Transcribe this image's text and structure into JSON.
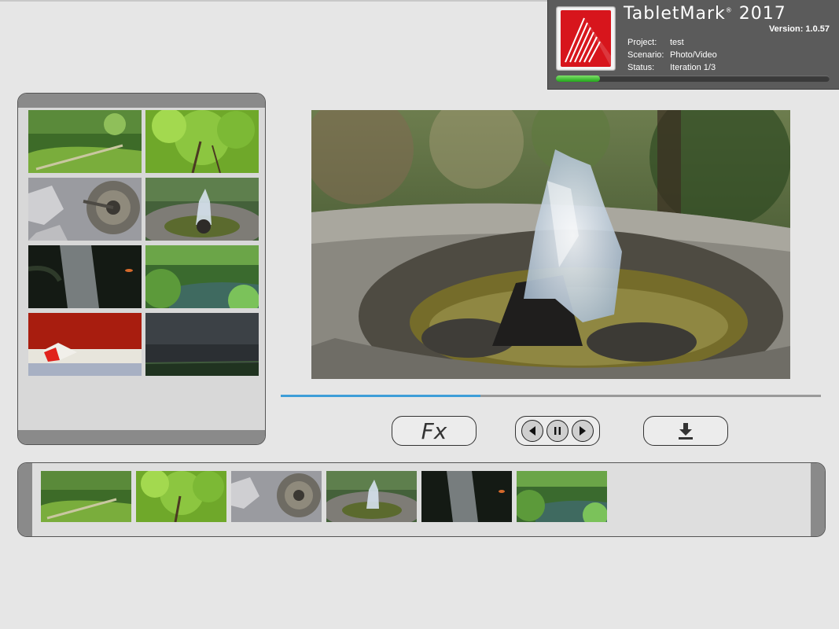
{
  "header": {
    "brand": "TabletMark",
    "brand_year": "2017",
    "version_label": "Version: 1.0.57",
    "project_key": "Project:",
    "project_value": "test",
    "scenario_key": "Scenario:",
    "scenario_value": "Photo/Video",
    "status_key": "Status:",
    "status_value": "Iteration 1/3",
    "progress_fraction": 0.16
  },
  "player": {
    "position_fraction": 0.37
  },
  "controls": {
    "fx_label": "Fx"
  },
  "colors": {
    "accent_blue": "#3d9ed8",
    "progress_green": "#22a61a",
    "logo_red": "#d7151c"
  },
  "icons": {
    "prev": "skip-back-icon",
    "pause": "pause-icon",
    "next": "skip-forward-icon",
    "download": "download-icon"
  }
}
